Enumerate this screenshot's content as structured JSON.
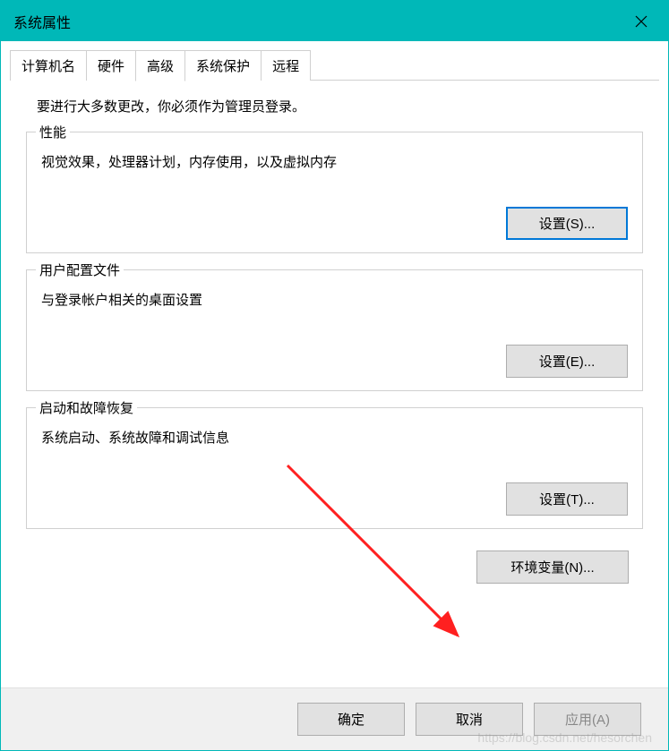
{
  "window": {
    "title": "系统属性"
  },
  "tabs": [
    {
      "label": "计算机名",
      "active": false
    },
    {
      "label": "硬件",
      "active": false
    },
    {
      "label": "高级",
      "active": true
    },
    {
      "label": "系统保护",
      "active": false
    },
    {
      "label": "远程",
      "active": false
    }
  ],
  "admin_note": "要进行大多数更改，你必须作为管理员登录。",
  "groups": {
    "performance": {
      "title": "性能",
      "desc": "视觉效果，处理器计划，内存使用，以及虚拟内存",
      "button": "设置(S)..."
    },
    "user_profiles": {
      "title": "用户配置文件",
      "desc": "与登录帐户相关的桌面设置",
      "button": "设置(E)..."
    },
    "startup": {
      "title": "启动和故障恢复",
      "desc": "系统启动、系统故障和调试信息",
      "button": "设置(T)..."
    }
  },
  "env_button": "环境变量(N)...",
  "footer": {
    "ok": "确定",
    "cancel": "取消",
    "apply": "应用(A)"
  },
  "watermark": "https://blog.csdn.net/hesorchen"
}
